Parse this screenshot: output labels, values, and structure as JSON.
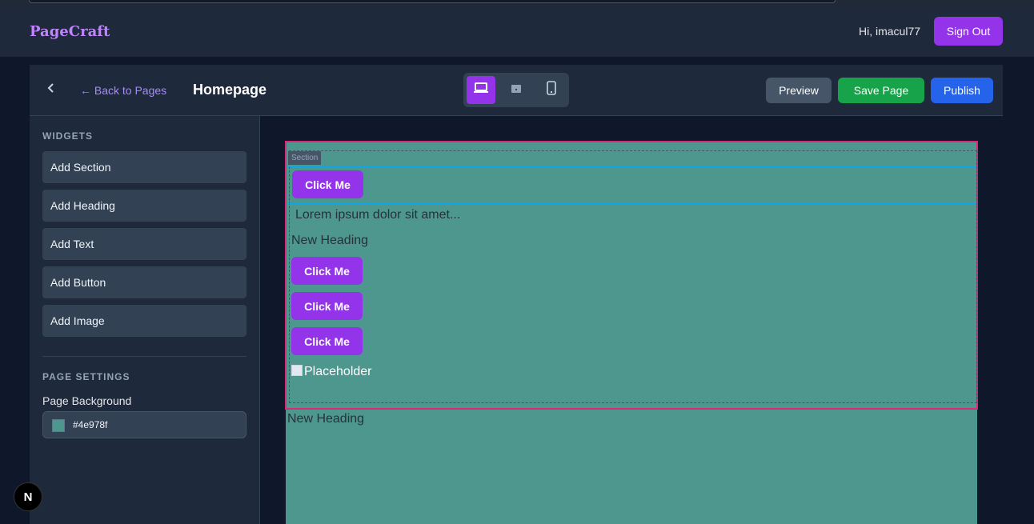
{
  "app": {
    "brand": "PageCraft"
  },
  "header": {
    "greeting": "Hi, imacul77",
    "signout_label": "Sign Out"
  },
  "toolbar": {
    "back_label": "← Back to Pages",
    "page_title": "Homepage",
    "devices": [
      "desktop-icon",
      "tablet-icon",
      "mobile-icon"
    ],
    "active_device": "desktop",
    "preview_label": "Preview",
    "save_label": "Save Page",
    "publish_label": "Publish"
  },
  "sidebar": {
    "widgets_title": "WIDGETS",
    "widgets": [
      {
        "label": "Add Section"
      },
      {
        "label": "Add Heading"
      },
      {
        "label": "Add Text"
      },
      {
        "label": "Add Button"
      },
      {
        "label": "Add Image"
      }
    ],
    "settings_title": "PAGE SETTINGS",
    "background_label": "Page Background",
    "background_value": "#4e978f"
  },
  "canvas": {
    "section_tag": "Section",
    "button_label": "Click Me",
    "text": "Lorem ipsum dolor sit amet...",
    "heading": "New Heading",
    "image_alt": "Placeholder",
    "outer_heading": "New Heading"
  },
  "colors": {
    "accent": "#9333ea",
    "save": "#16a34a",
    "publish": "#2563eb",
    "page_bg": "#4e978f"
  },
  "dev_badge": "N"
}
